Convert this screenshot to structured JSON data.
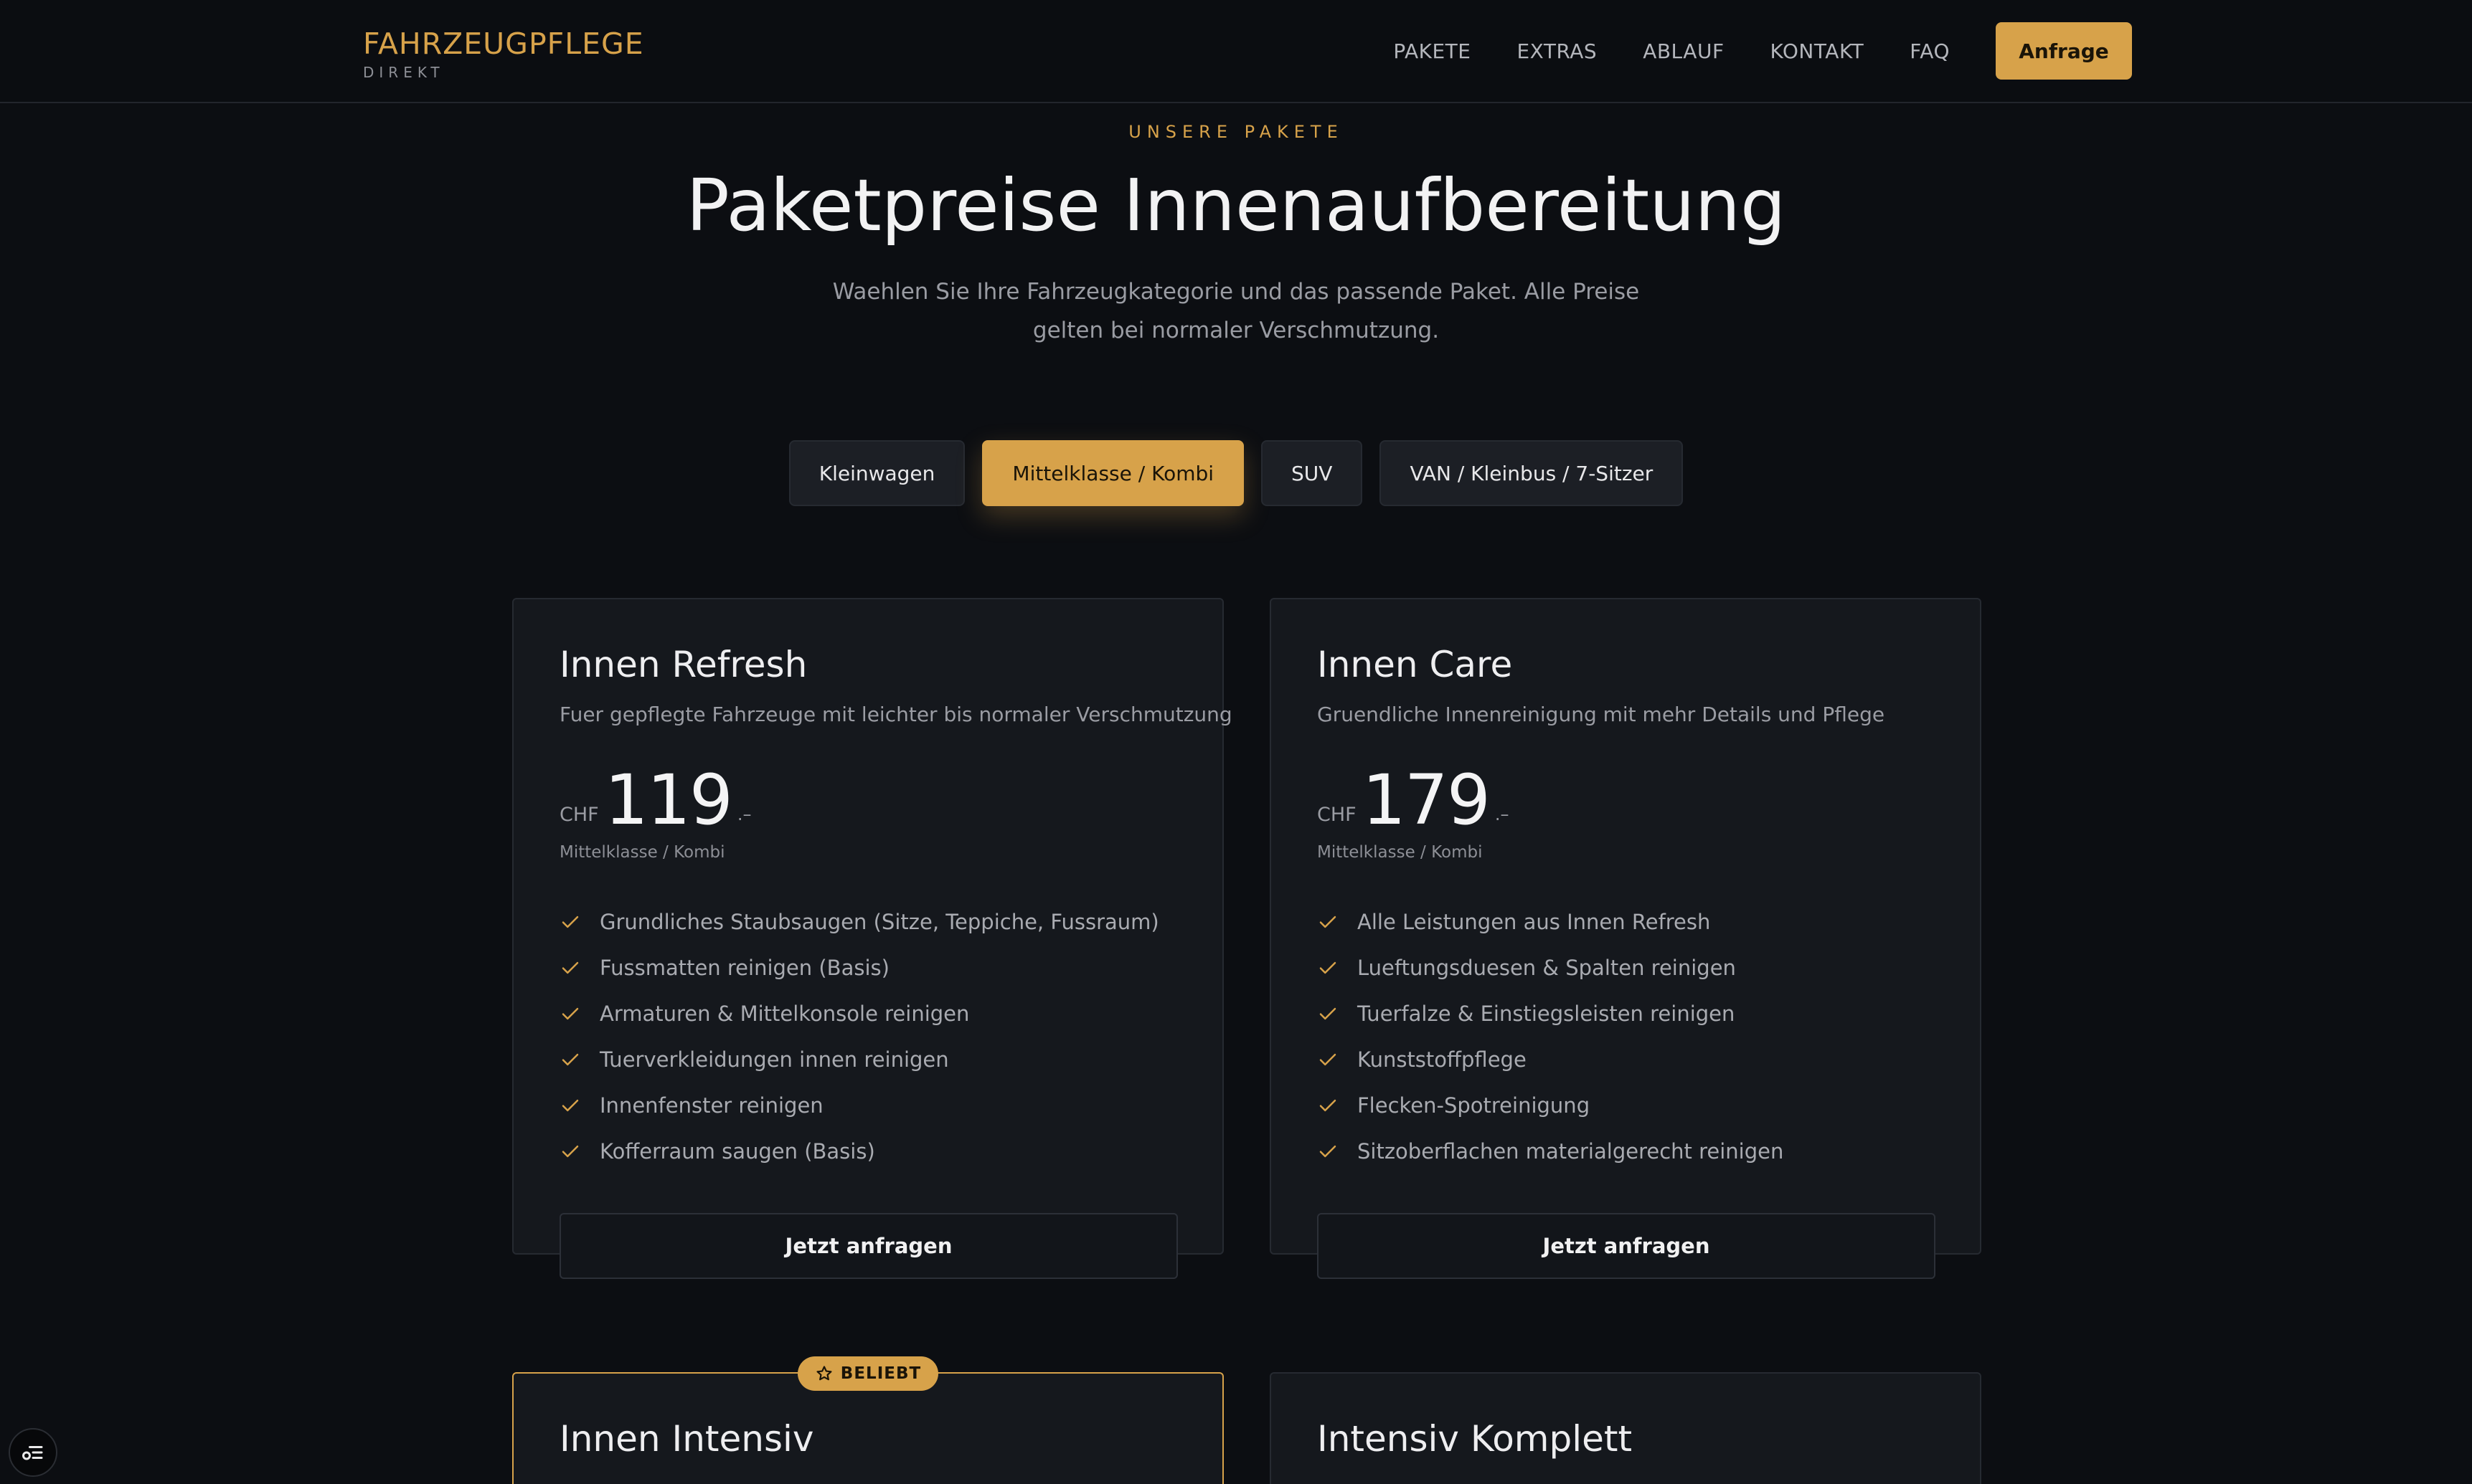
{
  "header": {
    "brand_name": "FAHRZEUGPFLEGE",
    "brand_sub": "DIREKT",
    "nav": [
      "PAKETE",
      "EXTRAS",
      "ABLAUF",
      "KONTAKT",
      "FAQ"
    ],
    "cta": "Anfrage"
  },
  "hero": {
    "eyebrow": "UNSERE PAKETE",
    "title": "Paketpreise Innenaufbereitung",
    "subtitle": "Waehlen Sie Ihre Fahrzeugkategorie und das passende Paket. Alle Preise gelten bei normaler Verschmutzung."
  },
  "tabs": [
    "Kleinwagen",
    "Mittelklasse / Kombi",
    "SUV",
    "VAN / Kleinbus / 7-Sitzer"
  ],
  "active_tab": "Mittelklasse / Kombi",
  "colors": {
    "accent": "#d7a24a",
    "background": "#0c0e12",
    "card": "#15181d"
  },
  "packages": [
    {
      "title": "Innen Refresh",
      "desc": "Fuer gepflegte Fahrzeuge mit leichter bis normaler Verschmutzung",
      "currency": "CHF",
      "price": "119",
      "suffix": ".–",
      "category": "Mittelklasse / Kombi",
      "features": [
        "Grundliches Staubsaugen (Sitze, Teppiche, Fussraum)",
        "Fussmatten reinigen (Basis)",
        "Armaturen & Mittelkonsole reinigen",
        "Tuerverkleidungen innen reinigen",
        "Innenfenster reinigen",
        "Kofferraum saugen (Basis)"
      ],
      "button": "Jetzt anfragen"
    },
    {
      "title": "Innen Care",
      "desc": "Gruendliche Innenreinigung mit mehr Details und Pflege",
      "currency": "CHF",
      "price": "179",
      "suffix": ".–",
      "category": "Mittelklasse / Kombi",
      "features": [
        "Alle Leistungen aus Innen Refresh",
        "Lueftungsduesen & Spalten reinigen",
        "Tuerfalze & Einstiegsleisten reinigen",
        "Kunststoffpflege",
        "Flecken-Spotreinigung",
        "Sitzoberflachen materialgerecht reinigen"
      ],
      "button": "Jetzt anfragen"
    },
    {
      "title": "Innen Intensiv",
      "badge": "BELIEBT"
    },
    {
      "title": "Intensiv Komplett"
    }
  ],
  "icons": {
    "check": "check-icon",
    "star": "star-icon",
    "widget": "settings-list-icon"
  }
}
